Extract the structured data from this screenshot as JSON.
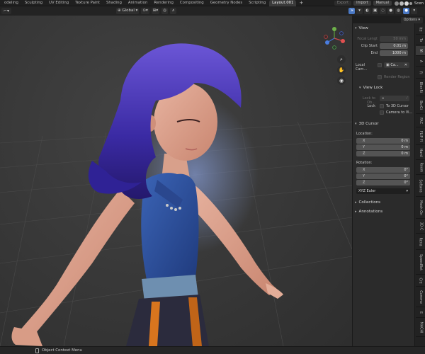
{
  "workspace_tabs": [
    "odeling",
    "Sculpting",
    "UV Editing",
    "Texture Paint",
    "Shading",
    "Animation",
    "Rendering",
    "Compositing",
    "Geometry Nodes",
    "Scripting",
    "Layout.001"
  ],
  "active_tab": "Layout.001",
  "add_tab_label": "+",
  "topbar_right": {
    "export": "Export",
    "import": "Import",
    "manual": "Manual",
    "scene": "Scen"
  },
  "header": {
    "transform_orientation": "Global",
    "options_label": "Options"
  },
  "viewport_context_menu": "Object Context Menu",
  "npanel": {
    "view": {
      "title": "View",
      "focal_length_label": "Focal Lengt",
      "focal_length_value": "50 mm",
      "clip_start_label": "Clip Start",
      "clip_start_value": "0.01 m",
      "end_label": "End",
      "end_value": "1000 m",
      "local_camera_label": "Local Cam...",
      "local_camera_value": "Ca...",
      "render_region_label": "Render Region",
      "view_lock_title": "View Lock",
      "lock_to_object_label": "Lock to Ob...",
      "lock_label": "Lock",
      "to_3d_cursor": "To 3D Cursor",
      "camera_to_view": "Camera to Vi..."
    },
    "cursor": {
      "title": "3D Cursor",
      "location_label": "Location:",
      "location": [
        {
          "axis": "X",
          "value": "0 m"
        },
        {
          "axis": "Y",
          "value": "0 m"
        },
        {
          "axis": "Z",
          "value": "0 m"
        }
      ],
      "rotation_label": "Rotation:",
      "rotation": [
        {
          "axis": "X",
          "value": "0°"
        },
        {
          "axis": "Y",
          "value": "0°"
        },
        {
          "axis": "Z",
          "value": "0°"
        }
      ],
      "rotation_mode": "XYZ Euler"
    },
    "collections_title": "Collections",
    "annotations_title": "Annotations"
  },
  "vertical_tabs": [
    "Ite",
    "To",
    "Vi",
    "A",
    "Fl",
    "BlenRi",
    "BsrGi",
    "FAC",
    "FLIP Fl",
    "Hard",
    "Room",
    "Softwra",
    "Mesh On",
    "3D-C",
    "Rena",
    "SpeedRet",
    "Cre",
    "Commo",
    "E",
    "MACHI"
  ],
  "active_vertical_tab": "Vi"
}
